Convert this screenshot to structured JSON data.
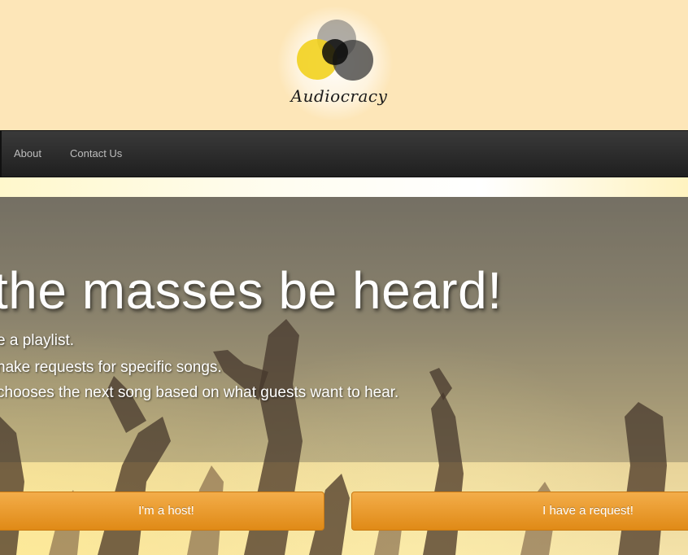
{
  "brand": {
    "name": "Audiocracy",
    "logo_icon": "overlapping-circles-logo"
  },
  "nav": {
    "items": [
      {
        "label": "About"
      },
      {
        "label": "Contact Us"
      }
    ]
  },
  "hero": {
    "title": "the masses be heard!",
    "lines": [
      "e a playlist.",
      "nake requests for specific songs.",
      "chooses the next song based on what guests want to hear."
    ],
    "host_button": "I'm a host!",
    "request_button": "I have a request!"
  },
  "colors": {
    "header_bg": "#fde6b8",
    "nav_bg": "#2a2a2a",
    "button_orange": "#e8941f",
    "logo_yellow": "#f5d43a"
  }
}
